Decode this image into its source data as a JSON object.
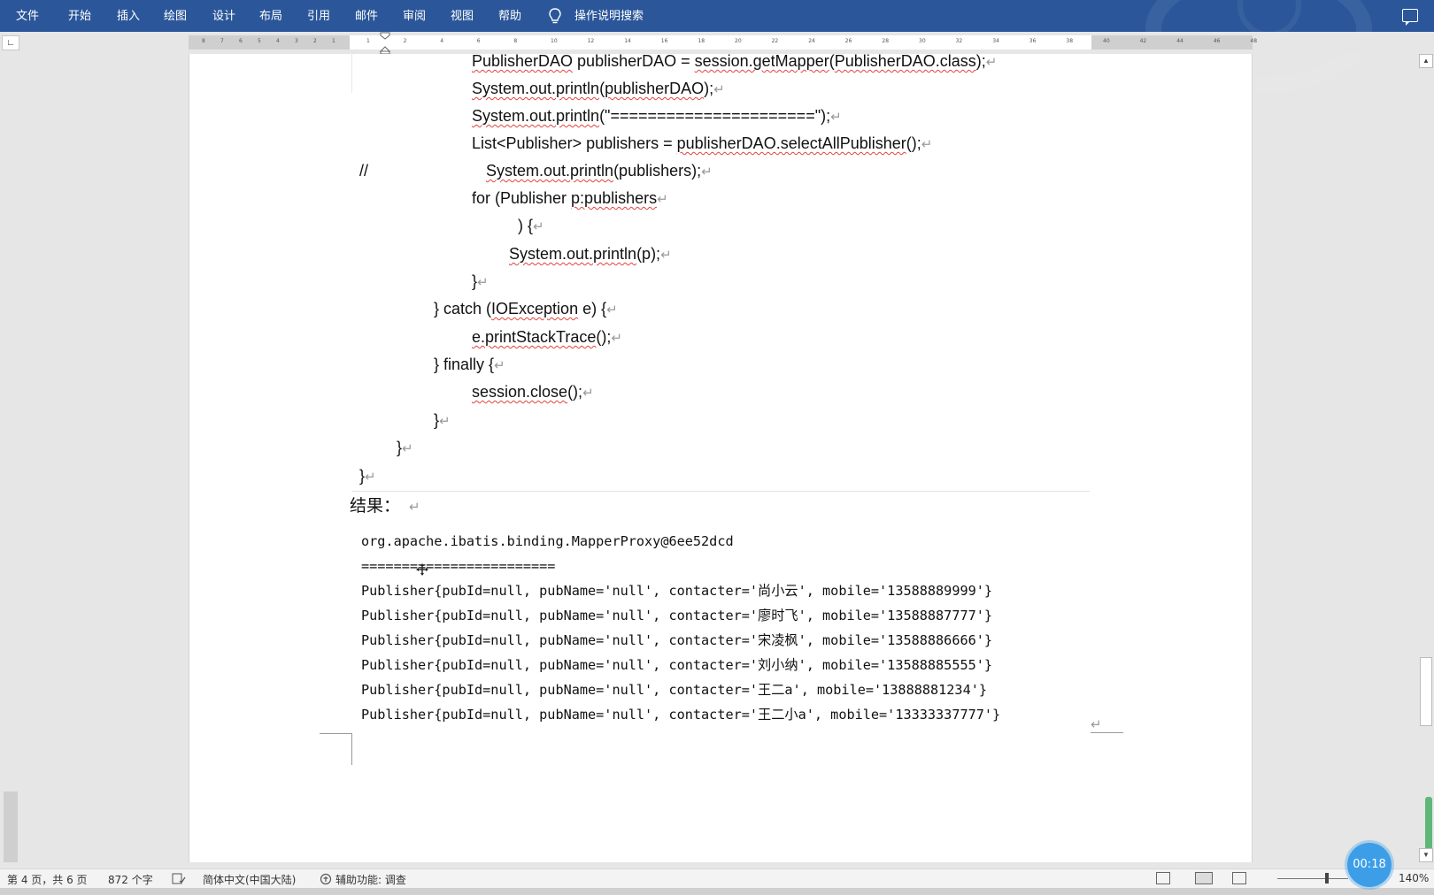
{
  "ribbon": {
    "tabs": [
      "文件",
      "开始",
      "插入",
      "绘图",
      "设计",
      "布局",
      "引用",
      "邮件",
      "审阅",
      "视图",
      "帮助"
    ],
    "search_label": "操作说明搜索"
  },
  "ruler": {
    "tab_selector": "∟",
    "left_numbers": [
      "8",
      "7",
      "6",
      "5",
      "4",
      "3",
      "2",
      "1"
    ],
    "right_numbers": [
      "1",
      "2",
      "4",
      "6",
      "8",
      "10",
      "12",
      "14",
      "16",
      "18",
      "20",
      "22",
      "24",
      "26",
      "28",
      "30",
      "32",
      "34",
      "36",
      "38",
      "40",
      "42",
      "44",
      "46",
      "48"
    ]
  },
  "code": {
    "l1": {
      "a": "PublisherDAO",
      "b": " publisherDAO = ",
      "c": "session.getMapper",
      "d": "(",
      "e": "PublisherDAO.class",
      "f": ");"
    },
    "l2": {
      "a": "System.out.println",
      "b": "(",
      "c": "publisherDAO",
      "d": ");"
    },
    "l3": {
      "a": "System.out.println",
      "b": "(\"======================\");"
    },
    "l4": {
      "a": "List<Publisher> publishers = ",
      "b": "publisherDAO.selectAllPublisher",
      "c": "();"
    },
    "l5_comment": "//",
    "l5": {
      "a": "System.out.println",
      "b": "(publishers);"
    },
    "l6": {
      "a": "for (Publisher ",
      "b": "p:publishers"
    },
    "l7": ") {",
    "l8": {
      "a": "System.out.println",
      "b": "(p);"
    },
    "l9": "}",
    "l10": {
      "a": "} catch (",
      "b": "IOException",
      "c": " e) {"
    },
    "l11": {
      "a": "e.printStackTrace",
      "b": "();"
    },
    "l12": "} finally {",
    "l13": {
      "a": "session.close",
      "b": "();"
    },
    "l14": "}",
    "l15": "}",
    "l16": "}",
    "pilcrow": "↵"
  },
  "result_label": "结果：",
  "output": [
    "org.apache.ibatis.binding.MapperProxy@6ee52dcd",
    "========================",
    "Publisher{pubId=null, pubName='null', contacter='尚小云', mobile='13588889999'}",
    "Publisher{pubId=null, pubName='null', contacter='廖时飞', mobile='13588887777'}",
    "Publisher{pubId=null, pubName='null', contacter='宋凌枫', mobile='13588886666'}",
    "Publisher{pubId=null, pubName='null', contacter='刘小纳', mobile='13588885555'}",
    "Publisher{pubId=null, pubName='null', contacter='王二a', mobile='13888881234'}",
    "Publisher{pubId=null, pubName='null', contacter='王二小a', mobile='13333337777'}"
  ],
  "status": {
    "page": "第 4 页，共 6 页",
    "words": "872 个字",
    "language": "简体中文(中国大陆)",
    "accessibility": "辅助功能: 调查",
    "zoom": "140%"
  },
  "timer": "00:18",
  "icons": [
    "lightbulb-icon",
    "comment-icon",
    "spell-check-icon",
    "accessibility-icon",
    "read-mode-icon",
    "print-layout-icon",
    "web-layout-icon",
    "scroll-up-icon",
    "scroll-down-icon"
  ]
}
